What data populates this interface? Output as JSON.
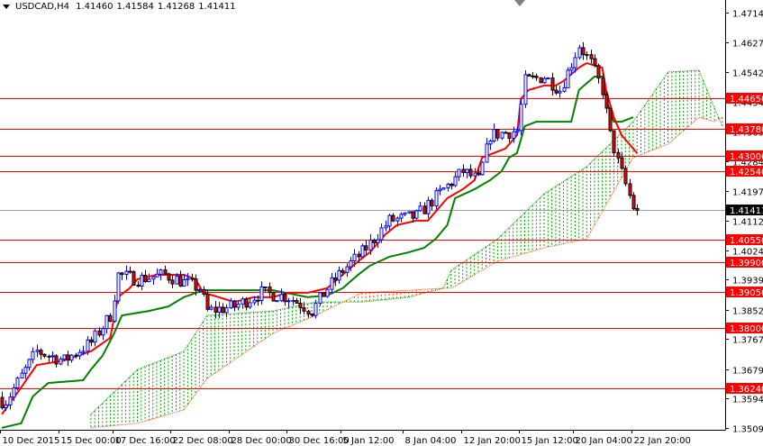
{
  "header": {
    "symbol": "USDCAD,H4",
    "open": "1.41460",
    "high": "1.41584",
    "low": "1.41268",
    "close": "1.41411"
  },
  "chart_data": {
    "type": "candlestick",
    "title": "USDCAD,H4",
    "indicator": "Ichimoku Kinko Hyo",
    "ylim": [
      1.35095,
      1.47145
    ],
    "x_unit": "bar",
    "bar_count": 165,
    "y_ticks": [
      "1.47145",
      "1.46270",
      "1.45420",
      "1.44545",
      "1.43695",
      "1.42845",
      "1.41970",
      "1.41120",
      "1.40245",
      "1.39395",
      "1.38520",
      "1.37670",
      "1.36795",
      "1.35945",
      "1.35095"
    ],
    "x_ticks": [
      {
        "bar": 0,
        "label": "10 Dec 2015"
      },
      {
        "bar": 15,
        "label": "15 Dec 00:00"
      },
      {
        "bar": 29,
        "label": "17 Dec 16:00"
      },
      {
        "bar": 44,
        "label": "22 Dec 08:00"
      },
      {
        "bar": 59,
        "label": "28 Dec 00:00"
      },
      {
        "bar": 74,
        "label": "30 Dec 16:00"
      },
      {
        "bar": 88,
        "label": "5 Jan 12:00"
      },
      {
        "bar": 104,
        "label": "8 Jan 04:00"
      },
      {
        "bar": 119,
        "label": "12 Jan 20:00"
      },
      {
        "bar": 134,
        "label": "15 Jan 12:00"
      },
      {
        "bar": 148,
        "label": "20 Jan 04:00"
      },
      {
        "bar": 163,
        "label": "22 Jan 20:00"
      }
    ],
    "levels": [
      "1.44650",
      "1.43780",
      "1.43000",
      "1.42540",
      "1.40550",
      "1.39900",
      "1.39050",
      "1.38000",
      "1.36240"
    ],
    "current_price": "1.41411",
    "last_candle": {
      "open": 1.4146,
      "high": 1.41584,
      "low": 1.41268,
      "close": 1.41411
    },
    "close_path": [
      [
        1,
        1.3588
      ],
      [
        9,
        1.3732
      ],
      [
        16,
        1.3705
      ],
      [
        23,
        1.3758
      ],
      [
        28,
        1.3836
      ],
      [
        30,
        1.3954
      ],
      [
        35,
        1.3941
      ],
      [
        42,
        1.3954
      ],
      [
        51,
        1.3915
      ],
      [
        53,
        1.3849
      ],
      [
        60,
        1.3862
      ],
      [
        67,
        1.3902
      ],
      [
        74,
        1.3889
      ],
      [
        80,
        1.3849
      ],
      [
        84,
        1.3915
      ],
      [
        88,
        1.3967
      ],
      [
        93,
        1.4019
      ],
      [
        100,
        1.4111
      ],
      [
        107,
        1.4124
      ],
      [
        114,
        1.4202
      ],
      [
        119,
        1.4254
      ],
      [
        123,
        1.4228
      ],
      [
        126,
        1.4359
      ],
      [
        133,
        1.4372
      ],
      [
        135,
        1.4516
      ],
      [
        140,
        1.4529
      ],
      [
        144,
        1.449
      ],
      [
        149,
        1.462
      ],
      [
        152,
        1.4568
      ],
      [
        155,
        1.449
      ],
      [
        157,
        1.4359
      ],
      [
        159,
        1.4281
      ],
      [
        163,
        1.415
      ],
      [
        164,
        1.4141
      ]
    ],
    "tenkan_sen": [
      [
        0,
        1.3549
      ],
      [
        5,
        1.3627
      ],
      [
        9,
        1.3692
      ],
      [
        16,
        1.3705
      ],
      [
        23,
        1.3732
      ],
      [
        28,
        1.3771
      ],
      [
        30,
        1.3889
      ],
      [
        33,
        1.3915
      ],
      [
        35,
        1.3941
      ],
      [
        40,
        1.3954
      ],
      [
        47,
        1.3954
      ],
      [
        50,
        1.3941
      ],
      [
        52,
        1.3902
      ],
      [
        56,
        1.3889
      ],
      [
        60,
        1.3875
      ],
      [
        65,
        1.3889
      ],
      [
        70,
        1.3889
      ],
      [
        74,
        1.3902
      ],
      [
        79,
        1.3902
      ],
      [
        84,
        1.3915
      ],
      [
        88,
        1.3954
      ],
      [
        92,
        1.3993
      ],
      [
        95,
        1.4019
      ],
      [
        99,
        1.4071
      ],
      [
        102,
        1.4098
      ],
      [
        107,
        1.4111
      ],
      [
        110,
        1.4111
      ],
      [
        113,
        1.415
      ],
      [
        115,
        1.4176
      ],
      [
        119,
        1.4202
      ],
      [
        122,
        1.4228
      ],
      [
        124,
        1.4294
      ],
      [
        127,
        1.4307
      ],
      [
        130,
        1.432
      ],
      [
        133,
        1.4359
      ],
      [
        134,
        1.4464
      ],
      [
        136,
        1.449
      ],
      [
        140,
        1.4503
      ],
      [
        143,
        1.4503
      ],
      [
        145,
        1.4516
      ],
      [
        149,
        1.4555
      ],
      [
        151,
        1.4568
      ],
      [
        155,
        1.4555
      ],
      [
        156,
        1.449
      ],
      [
        158,
        1.4411
      ],
      [
        160,
        1.4359
      ],
      [
        164,
        1.4307
      ]
    ],
    "kijun_sen": [
      [
        0,
        1.351
      ],
      [
        5,
        1.3523
      ],
      [
        8,
        1.3601
      ],
      [
        12,
        1.364
      ],
      [
        21,
        1.3648
      ],
      [
        23,
        1.3679
      ],
      [
        26,
        1.3719
      ],
      [
        29,
        1.3784
      ],
      [
        31,
        1.3836
      ],
      [
        38,
        1.3849
      ],
      [
        43,
        1.3862
      ],
      [
        47,
        1.3889
      ],
      [
        52,
        1.3909
      ],
      [
        70,
        1.3909
      ],
      [
        79,
        1.3889
      ],
      [
        84,
        1.3894
      ],
      [
        88,
        1.3915
      ],
      [
        92,
        1.3954
      ],
      [
        95,
        1.398
      ],
      [
        100,
        1.4006
      ],
      [
        105,
        1.4019
      ],
      [
        109,
        1.4032
      ],
      [
        112,
        1.4058
      ],
      [
        115,
        1.4098
      ],
      [
        117,
        1.4176
      ],
      [
        122,
        1.4202
      ],
      [
        126,
        1.4228
      ],
      [
        129,
        1.4254
      ],
      [
        131,
        1.4294
      ],
      [
        133,
        1.4307
      ],
      [
        135,
        1.4385
      ],
      [
        138,
        1.4398
      ],
      [
        147,
        1.4398
      ],
      [
        149,
        1.449
      ],
      [
        153,
        1.4529
      ],
      [
        155,
        1.4529
      ],
      [
        156,
        1.4464
      ],
      [
        158,
        1.4398
      ],
      [
        160,
        1.4398
      ],
      [
        163,
        1.4411
      ]
    ],
    "senkou_span_a": [
      [
        23,
        1.3549
      ],
      [
        35,
        1.3679
      ],
      [
        47,
        1.3732
      ],
      [
        53,
        1.3836
      ],
      [
        70,
        1.3849
      ],
      [
        81,
        1.3875
      ],
      [
        93,
        1.3875
      ],
      [
        105,
        1.3889
      ],
      [
        114,
        1.3915
      ],
      [
        116,
        1.3967
      ],
      [
        128,
        1.4058
      ],
      [
        140,
        1.4189
      ],
      [
        151,
        1.4268
      ],
      [
        163,
        1.4398
      ],
      [
        172,
        1.4542
      ],
      [
        180,
        1.4547
      ],
      [
        184,
        1.4438
      ],
      [
        186,
        1.4385
      ]
    ],
    "senkou_span_b": [
      [
        23,
        1.351
      ],
      [
        35,
        1.3523
      ],
      [
        47,
        1.3562
      ],
      [
        53,
        1.3653
      ],
      [
        70,
        1.3784
      ],
      [
        81,
        1.3836
      ],
      [
        93,
        1.3902
      ],
      [
        105,
        1.3909
      ],
      [
        114,
        1.3915
      ],
      [
        116,
        1.3915
      ],
      [
        128,
        1.3993
      ],
      [
        140,
        1.4032
      ],
      [
        151,
        1.4058
      ],
      [
        163,
        1.4294
      ],
      [
        172,
        1.4333
      ],
      [
        180,
        1.4411
      ],
      [
        184,
        1.4398
      ],
      [
        186,
        1.4411
      ]
    ],
    "colors": {
      "bull_body": "#ffffff",
      "bull_outline": "#0000ff",
      "bear_body": "#ff0000",
      "bear_outline": "#000000",
      "tenkan": "#ff0000",
      "kijun": "#008000",
      "cloud_bull": "#00a000",
      "cloud_bear": "#ff4500",
      "level": "#ff0000",
      "current_label": "#000000"
    }
  }
}
